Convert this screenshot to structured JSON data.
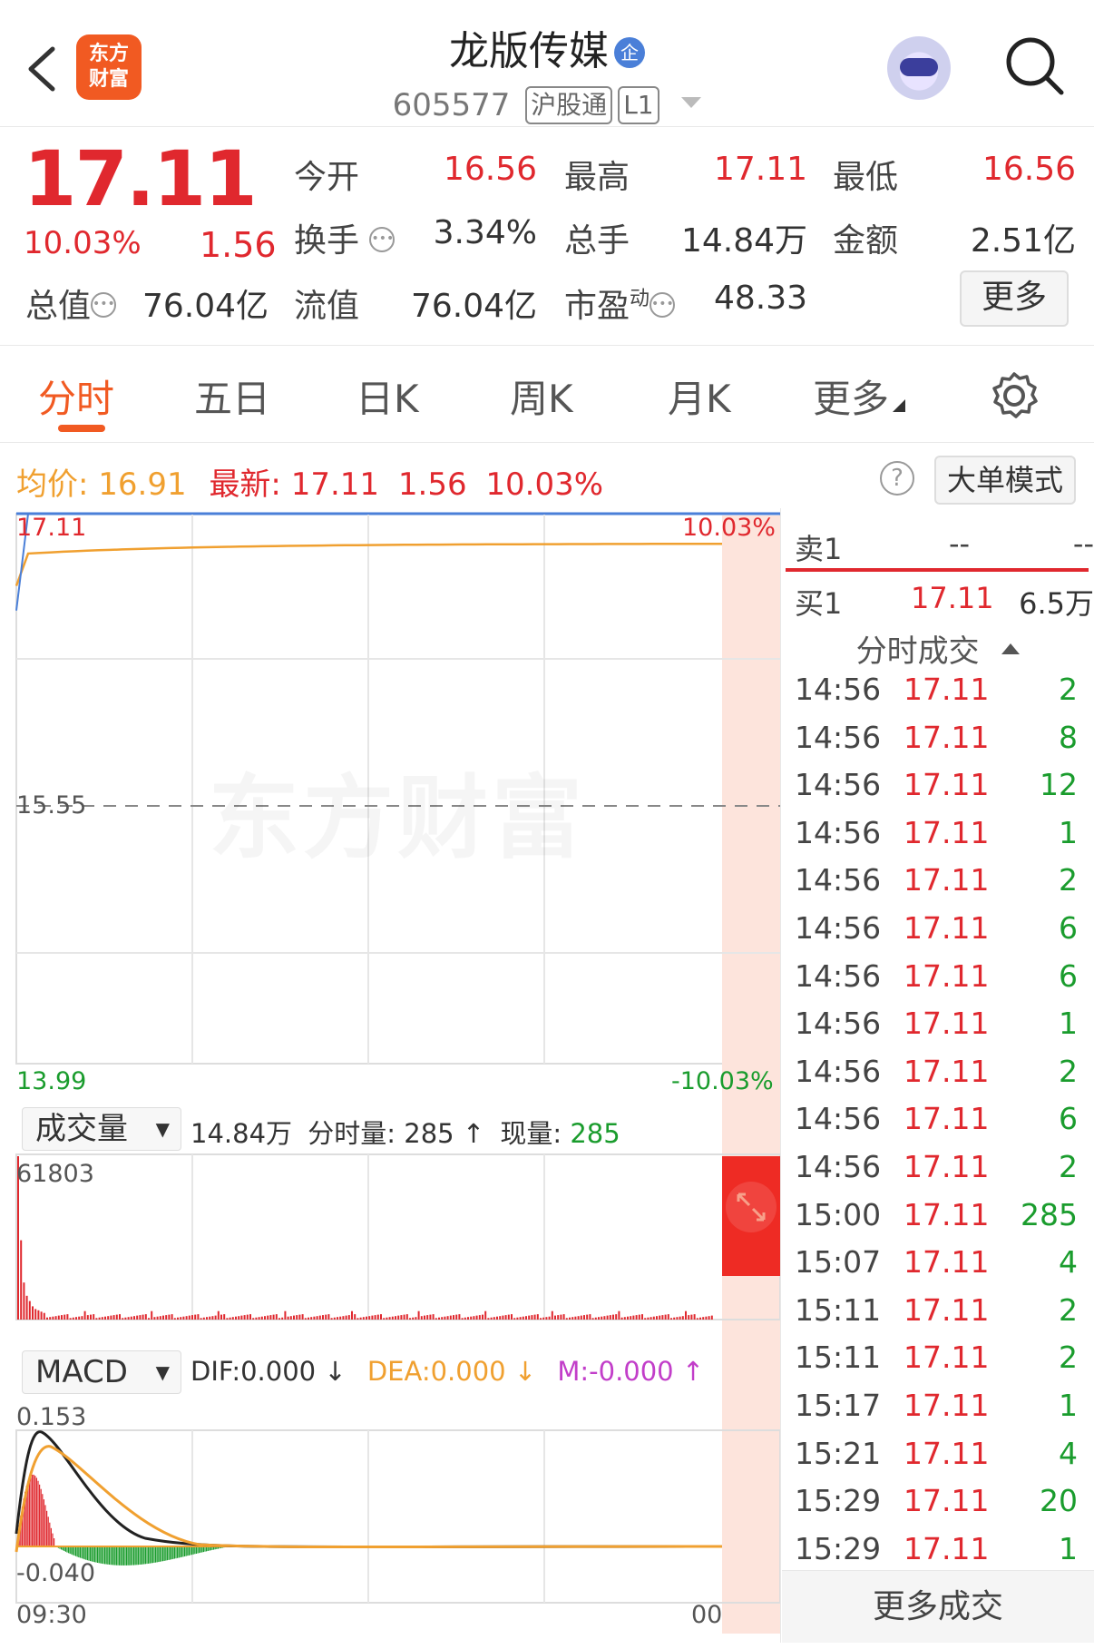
{
  "header": {
    "logo_text": "东方\n财富",
    "title": "龙版传媒",
    "title_badge": "企",
    "code": "605577",
    "tag1": "沪股通",
    "tag2": "L1"
  },
  "quote": {
    "price": "17.11",
    "change_pct": "10.03%",
    "change": "1.56",
    "open_label": "今开",
    "open": "16.56",
    "high_label": "最高",
    "high": "17.11",
    "low_label": "最低",
    "low": "16.56",
    "turnover_label": "换手",
    "turnover": "3.34%",
    "volume_label": "总手",
    "volume": "14.84万",
    "amount_label": "金额",
    "amount": "2.51亿",
    "mktcap_label": "总值",
    "mktcap": "76.04亿",
    "float_label": "流值",
    "float": "76.04亿",
    "pe_label": "市盈",
    "pe_sup": "动",
    "pe": "48.33",
    "more_label": "更多"
  },
  "tabs": [
    {
      "label": "分时",
      "active": true
    },
    {
      "label": "五日"
    },
    {
      "label": "日K"
    },
    {
      "label": "周K"
    },
    {
      "label": "月K"
    },
    {
      "label": "更多"
    }
  ],
  "infoline": {
    "avg_label": "均价:",
    "avg": "16.91",
    "last_label": "最新:",
    "last": "17.11",
    "chg": "1.56",
    "pct": "10.03%",
    "help": "?",
    "big_order_label": "大单模式"
  },
  "price_chart": {
    "top_left": "17.11",
    "top_right": "10.03%",
    "mid_left": "15.55",
    "bottom_left": "13.99",
    "bottom_right": "-10.03%",
    "watermark": "东方财富"
  },
  "volume_panel": {
    "selector": "成交量",
    "total": "14.84万",
    "minute_label": "分时量:",
    "minute_vol": "285",
    "minute_arrow": "↑",
    "current_label": "现量:",
    "current": "285",
    "max_label": "61803"
  },
  "macd_panel": {
    "selector": "MACD",
    "dif": "DIF:0.000 ↓",
    "dea": "DEA:0.000 ↓",
    "m": "M:-0.000 ↑",
    "top_label": "0.153",
    "bottom_label": "-0.040",
    "time_start": "09:30",
    "time_end": "00"
  },
  "order_book": {
    "sell1_label": "卖1",
    "sell1_price": "--",
    "sell1_vol": "--",
    "buy1_label": "买1",
    "buy1_price": "17.11",
    "buy1_vol": "6.5万"
  },
  "trades_header": "分时成交",
  "trades": [
    {
      "time": "14:56",
      "price": "17.11",
      "vol": "2"
    },
    {
      "time": "14:56",
      "price": "17.11",
      "vol": "8"
    },
    {
      "time": "14:56",
      "price": "17.11",
      "vol": "12"
    },
    {
      "time": "14:56",
      "price": "17.11",
      "vol": "1"
    },
    {
      "time": "14:56",
      "price": "17.11",
      "vol": "2"
    },
    {
      "time": "14:56",
      "price": "17.11",
      "vol": "6"
    },
    {
      "time": "14:56",
      "price": "17.11",
      "vol": "6"
    },
    {
      "time": "14:56",
      "price": "17.11",
      "vol": "1"
    },
    {
      "time": "14:56",
      "price": "17.11",
      "vol": "2"
    },
    {
      "time": "14:56",
      "price": "17.11",
      "vol": "6"
    },
    {
      "time": "14:56",
      "price": "17.11",
      "vol": "2"
    },
    {
      "time": "15:00",
      "price": "17.11",
      "vol": "285"
    },
    {
      "time": "15:07",
      "price": "17.11",
      "vol": "4"
    },
    {
      "time": "15:11",
      "price": "17.11",
      "vol": "2"
    },
    {
      "time": "15:11",
      "price": "17.11",
      "vol": "2"
    },
    {
      "time": "15:17",
      "price": "17.11",
      "vol": "1"
    },
    {
      "time": "15:21",
      "price": "17.11",
      "vol": "4"
    },
    {
      "time": "15:29",
      "price": "17.11",
      "vol": "20"
    },
    {
      "time": "15:29",
      "price": "17.11",
      "vol": "1"
    }
  ],
  "more_trades_label": "更多成交",
  "colors": {
    "up": "#e0282e",
    "down": "#1a9c2d",
    "avg": "#f0a030",
    "accent": "#f15a22"
  }
}
